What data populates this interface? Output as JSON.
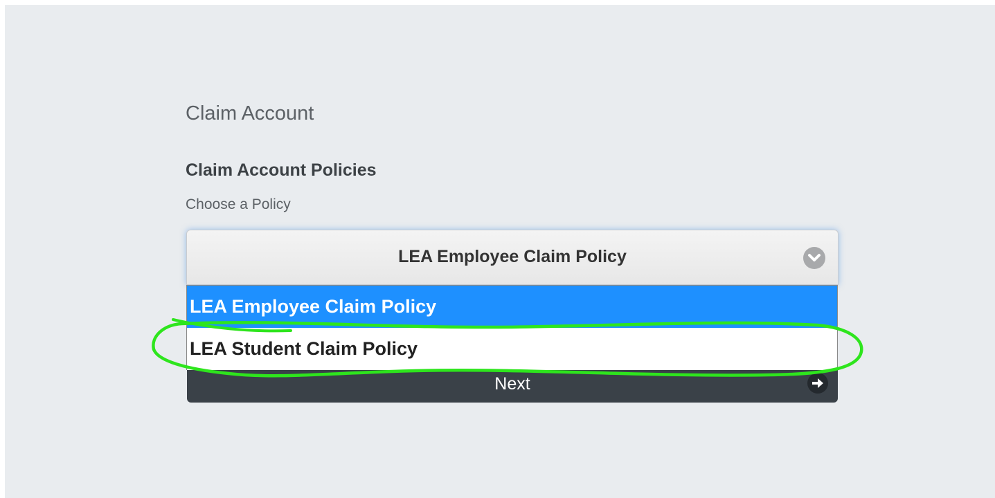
{
  "page": {
    "title": "Claim Account"
  },
  "section": {
    "title": "Claim Account Policies",
    "field_label": "Choose a Policy"
  },
  "policy_select": {
    "selected_value": "LEA Employee Claim Policy",
    "options": [
      {
        "label": "LEA Employee Claim Policy",
        "selected": true
      },
      {
        "label": "LEA Student Claim Policy",
        "selected": false
      }
    ]
  },
  "next_button": {
    "label": "Next"
  },
  "colors": {
    "background": "#e9ecef",
    "highlight": "#1e90ff",
    "button": "#3a4148",
    "annotation_stroke": "#2ee51d"
  },
  "icons": {
    "select_toggle": "chevron-down-icon",
    "next": "arrow-right-icon"
  }
}
